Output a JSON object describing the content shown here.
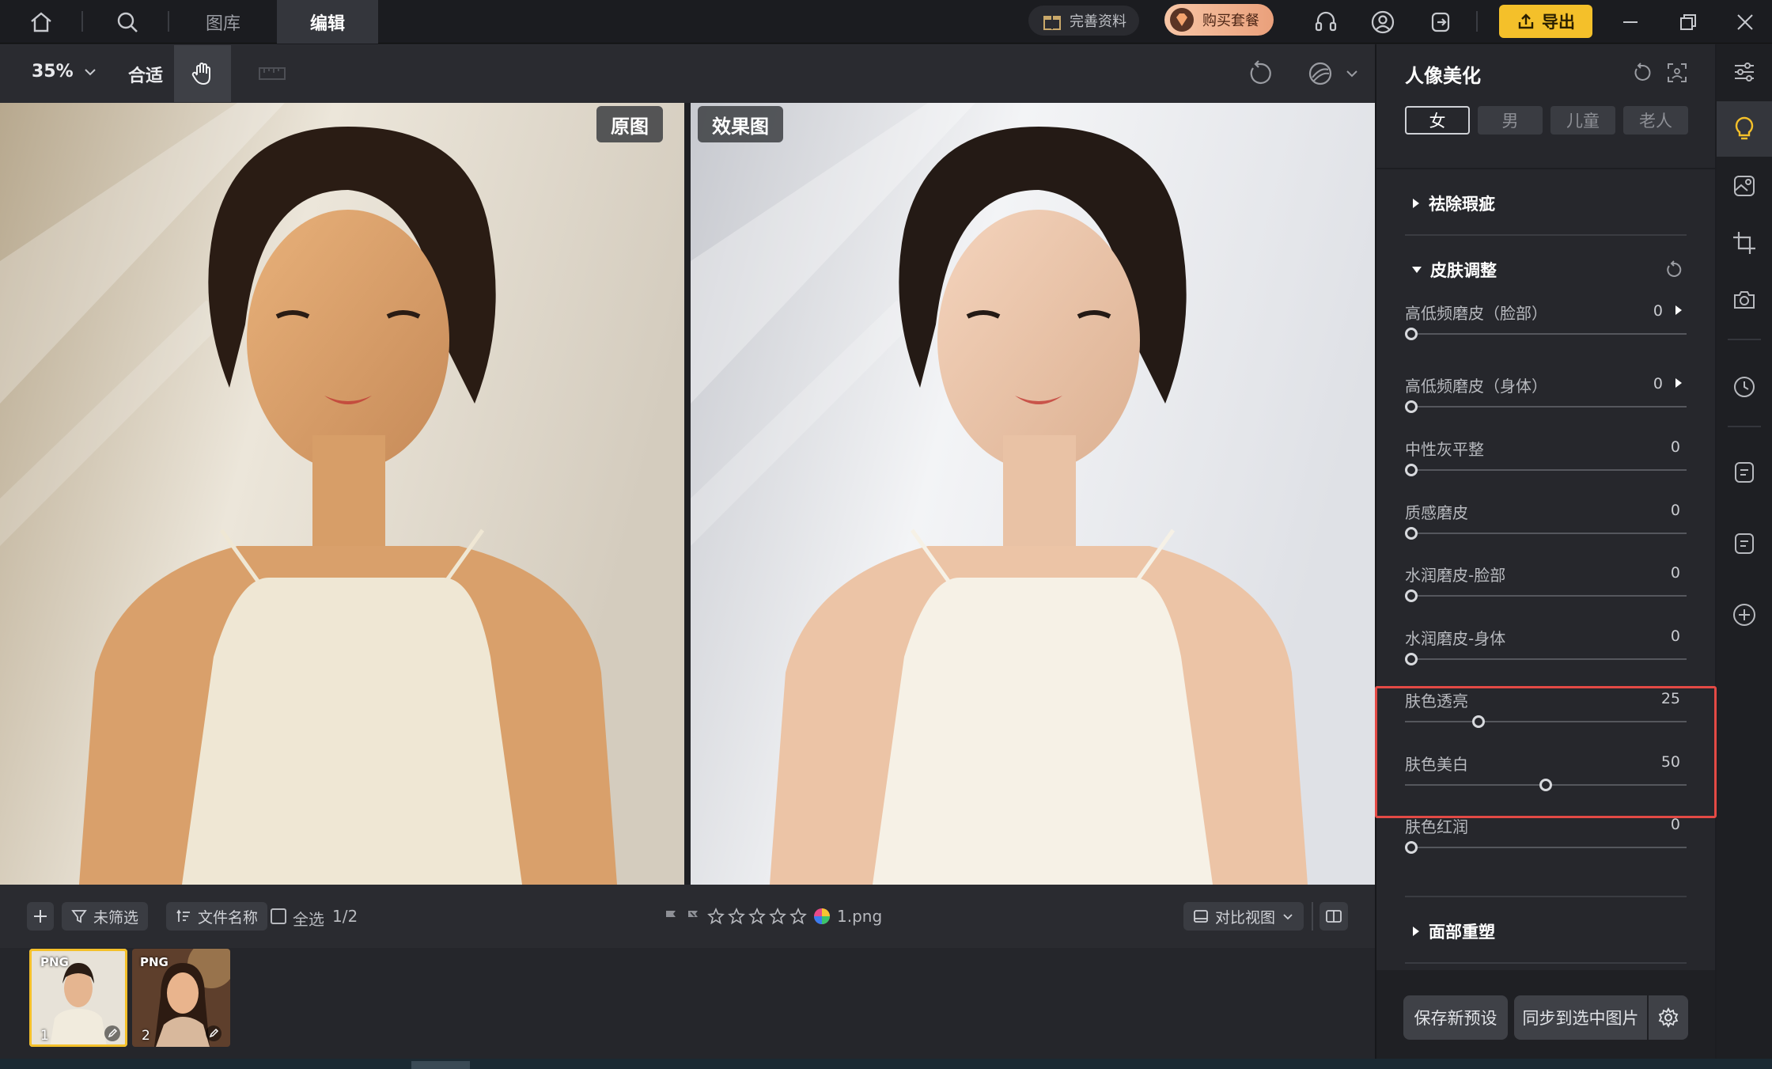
{
  "topbar": {
    "tabs": [
      {
        "label": "图库",
        "active": false
      },
      {
        "label": "编辑",
        "active": true
      }
    ],
    "complete_profile_label": "完善资料",
    "buy_package_label": "购买套餐",
    "export_label": "导出",
    "icons": [
      "home-icon",
      "search-icon",
      "gift-icon",
      "diamond-icon",
      "headset-icon",
      "user-icon",
      "logout-icon",
      "upload-icon",
      "minimize-icon",
      "restore-icon",
      "close-icon"
    ]
  },
  "toolbar": {
    "zoom_value": "35%",
    "fit_label": "合适",
    "icons": [
      "hand-icon",
      "ruler-icon",
      "undo-rotate-icon",
      "overlay-icon",
      "chevron-down-icon"
    ]
  },
  "canvas": {
    "original_label": "原图",
    "effect_label": "效果图"
  },
  "bottombar": {
    "unfiltered_label": "未筛选",
    "filename_sort_label": "文件名称",
    "select_all_label": "全选",
    "selection_count": "1/2",
    "current_file": "1.png",
    "rating_stars": 5,
    "compare_view_label": "对比视图"
  },
  "filmstrip": {
    "items": [
      {
        "badge": "PNG",
        "index": "1",
        "selected": true
      },
      {
        "badge": "PNG",
        "index": "2",
        "selected": false
      }
    ]
  },
  "panel": {
    "title": "人像美化",
    "genders": [
      {
        "label": "女",
        "active": true
      },
      {
        "label": "男",
        "active": false
      },
      {
        "label": "儿童",
        "active": false
      },
      {
        "label": "老人",
        "active": false
      }
    ],
    "section_blemish": "祛除瑕疵",
    "section_skin": "皮肤调整",
    "section_face": "面部重塑",
    "sliders": [
      {
        "label": "高低频磨皮（脸部）",
        "value": "0",
        "fraction": 0.0,
        "expandable": true
      },
      {
        "label": "高低频磨皮（身体）",
        "value": "0",
        "fraction": 0.0,
        "expandable": true
      },
      {
        "label": "中性灰平整",
        "value": "0",
        "fraction": 0.0,
        "expandable": false
      },
      {
        "label": "质感磨皮",
        "value": "0",
        "fraction": 0.0,
        "expandable": false
      },
      {
        "label": "水润磨皮-脸部",
        "value": "0",
        "fraction": 0.0,
        "expandable": false
      },
      {
        "label": "水润磨皮-身体",
        "value": "0",
        "fraction": 0.0,
        "expandable": false
      },
      {
        "label": "肤色透亮",
        "value": "25",
        "fraction": 0.25,
        "expandable": false
      },
      {
        "label": "肤色美白",
        "value": "50",
        "fraction": 0.5,
        "expandable": false
      },
      {
        "label": "肤色红润",
        "value": "0",
        "fraction": 0.0,
        "expandable": false
      }
    ],
    "save_preset_label": "保存新预设",
    "sync_label": "同步到选中图片"
  },
  "rail": {
    "icons": [
      "sliders-icon",
      "lightbulb-icon",
      "image-edit-icon",
      "crop-icon",
      "camera-icon",
      "history-icon",
      "note-icon",
      "note-alt-icon",
      "add-circle-icon"
    ]
  },
  "colors": {
    "accent": "#f4c02a",
    "highlight": "#e34a45",
    "panel_bg": "#26272c"
  }
}
